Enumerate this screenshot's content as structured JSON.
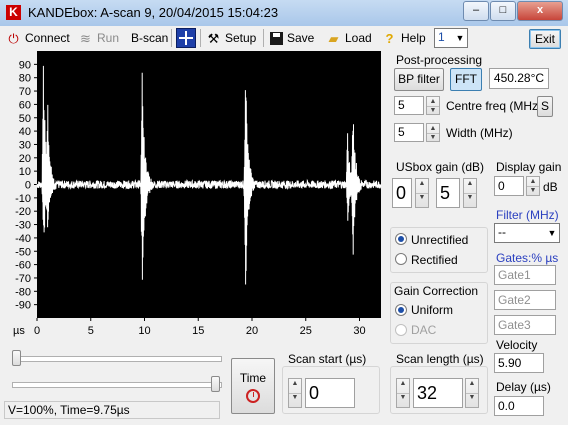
{
  "window": {
    "title": "KANDEbox: A-scan 9, 20/04/2015 15:04:23",
    "controls": {
      "minimize": "–",
      "maximize": "□",
      "close": "x"
    }
  },
  "toolbar": {
    "connect": "Connect",
    "run": "Run",
    "bscan": "B-scan",
    "setup": "Setup",
    "save": "Save",
    "load": "Load",
    "help": "Help",
    "channel_value": "1",
    "exit": "Exit"
  },
  "postprocessing": {
    "title": "Post-processing",
    "bp_filter": "BP filter",
    "fft": "FFT",
    "temperature": "450.28°C",
    "centre_freq_value": "5",
    "centre_freq_label": "Centre freq (MHz)",
    "s_button": "S",
    "width_value": "5",
    "width_label": "Width (MHz)"
  },
  "usbox_gain": {
    "label": "USbox gain (dB)",
    "coarse": "0",
    "fine": "5"
  },
  "display_gain": {
    "label": "Display gain",
    "value": "0",
    "unit": "dB"
  },
  "filter": {
    "label": "Filter (MHz)",
    "value": "--"
  },
  "gates": {
    "label": "Gates:% µs",
    "gate1": "Gate1",
    "gate2": "Gate2",
    "gate3": "Gate3"
  },
  "rectification": {
    "unrectified": "Unrectified",
    "rectified": "Rectified",
    "selected": "Unrectified"
  },
  "gain_correction": {
    "title": "Gain Correction",
    "uniform": "Uniform",
    "dac": "DAC",
    "selected": "Uniform"
  },
  "velocity": {
    "label": "Velocity",
    "value": "5.90"
  },
  "delay": {
    "label": "Delay (µs)",
    "value": "0.0"
  },
  "scan_start": {
    "label": "Scan start (µs)",
    "value": "0"
  },
  "scan_length": {
    "label": "Scan length (µs)",
    "value": "32"
  },
  "time_button": {
    "label": "Time"
  },
  "sliders": {
    "top_position": 0.0,
    "bottom_position": 1.0
  },
  "status": "V=100%, Time=9.75µs",
  "chart_data": {
    "type": "line",
    "xlabel": "µs",
    "ylabel": "",
    "xlim": [
      0,
      32
    ],
    "ylim": [
      -100,
      100
    ],
    "x_ticks": [
      0,
      5,
      10,
      15,
      20,
      25,
      30
    ],
    "y_ticks": [
      90,
      80,
      70,
      60,
      50,
      40,
      30,
      20,
      10,
      0,
      -10,
      -20,
      -30,
      -40,
      -50,
      -60,
      -70,
      -80,
      -90
    ],
    "grid": false,
    "background": "#000000",
    "trace_color": "#ffffff",
    "echoes": [
      {
        "t": 0.6,
        "max": 95,
        "min": -50
      },
      {
        "t": 1.0,
        "max": 45,
        "min": -30
      },
      {
        "t": 9.8,
        "max": 93,
        "min": -93
      },
      {
        "t": 19.4,
        "max": 90,
        "min": -80
      },
      {
        "t": 28.9,
        "max": 39,
        "min": -30
      },
      {
        "t": 29.4,
        "max": 55,
        "min": -55
      }
    ],
    "baseline_noise": 3
  }
}
